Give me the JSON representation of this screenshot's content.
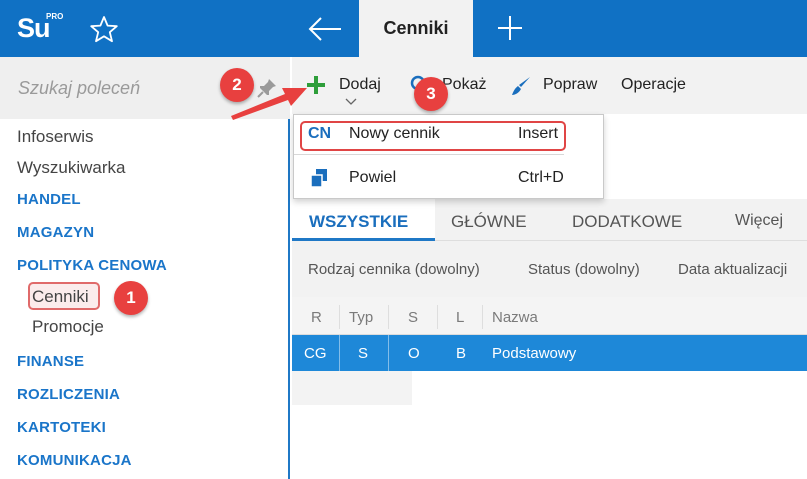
{
  "app": {
    "logo_text": "Su",
    "logo_badge": "PRO"
  },
  "topbar": {
    "active_tab": "Cenniki"
  },
  "search": {
    "placeholder": "Szukaj poleceń"
  },
  "sidebar": {
    "items": [
      {
        "label": "Infoserwis",
        "kind": "item"
      },
      {
        "label": "Wyszukiwarka",
        "kind": "item"
      },
      {
        "label": "HANDEL",
        "kind": "category"
      },
      {
        "label": "MAGAZYN",
        "kind": "category"
      },
      {
        "label": "POLITYKA CENOWA",
        "kind": "category"
      },
      {
        "label": "Cenniki",
        "kind": "subitem",
        "selected": true
      },
      {
        "label": "Promocje",
        "kind": "subitem"
      },
      {
        "label": "FINANSE",
        "kind": "category"
      },
      {
        "label": "ROZLICZENIA",
        "kind": "category"
      },
      {
        "label": "KARTOTEKI",
        "kind": "category"
      },
      {
        "label": "KOMUNIKACJA",
        "kind": "category"
      }
    ]
  },
  "toolbar": {
    "add_label": "Dodaj",
    "show_label": "Pokaż",
    "edit_label": "Popraw",
    "operations_label": "Operacje"
  },
  "dropdown": {
    "items": [
      {
        "code": "CN",
        "label": "Nowy cennik",
        "shortcut": "Insert"
      },
      {
        "code": "",
        "label": "Powiel",
        "shortcut": "Ctrl+D"
      }
    ]
  },
  "tabs": [
    {
      "label": "WSZYSTKIE",
      "selected": true
    },
    {
      "label": "GŁÓWNE"
    },
    {
      "label": "DODATKOWE"
    },
    {
      "label": "Więcej"
    }
  ],
  "filters": [
    {
      "label": "Rodzaj cennika (dowolny)"
    },
    {
      "label": "Status (dowolny)"
    },
    {
      "label": "Data aktualizacji"
    }
  ],
  "table": {
    "columns": [
      "R",
      "Typ",
      "S",
      "L",
      "Nazwa"
    ],
    "rows": [
      [
        "CG",
        "S",
        "O",
        "B",
        "Podstawowy"
      ]
    ]
  },
  "callouts": [
    "1",
    "2",
    "3"
  ],
  "colors": {
    "brand_blue": "#1071c4",
    "accent_blue": "#1a6ebd",
    "row_selected": "#1e88d8",
    "callout_red": "#e8403f",
    "add_green": "#2e9e3a"
  },
  "icons": [
    "star-icon",
    "back-arrow-icon",
    "plus-icon",
    "pin-icon",
    "add-icon",
    "search-icon",
    "brush-icon",
    "chevron-down-icon",
    "copy-icon"
  ]
}
